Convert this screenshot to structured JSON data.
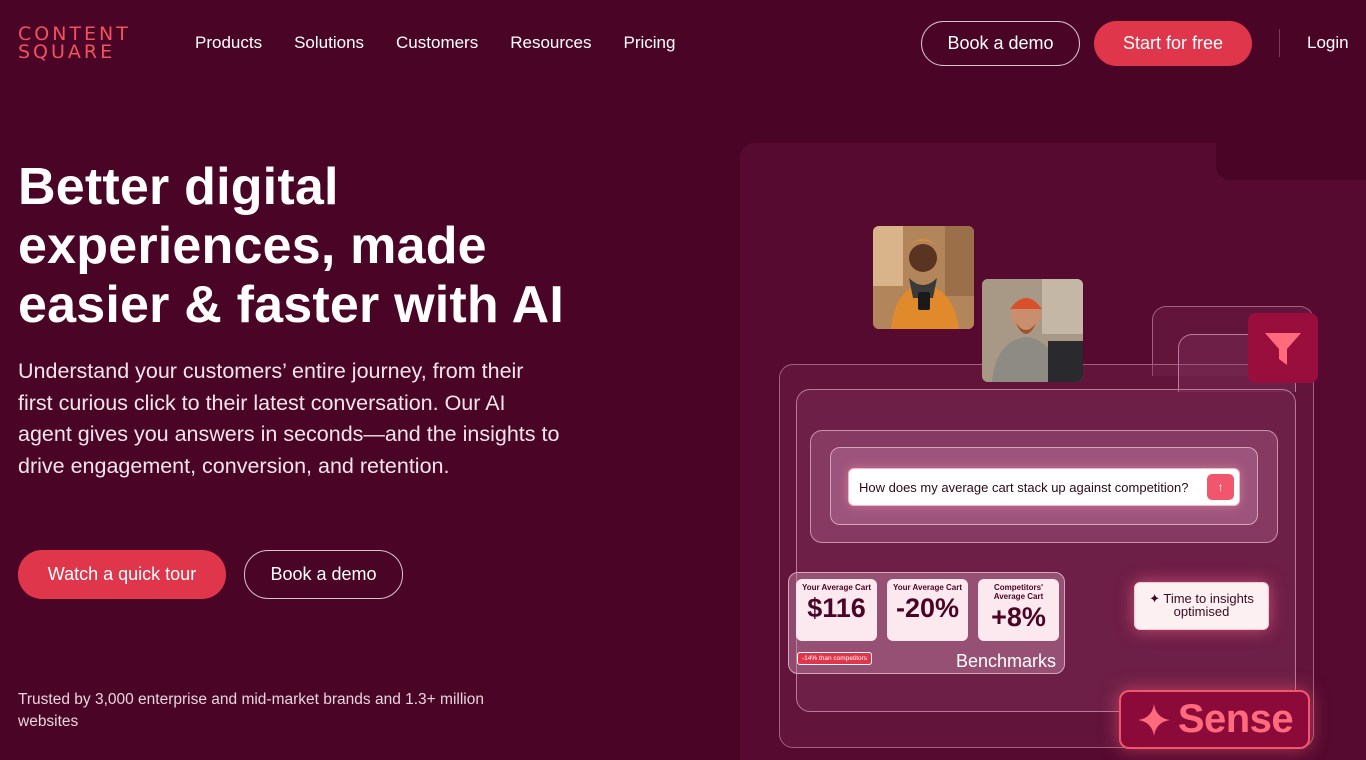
{
  "brand": {
    "logo_line1": "CONTENT",
    "logo_line2": "SQUARE"
  },
  "nav": {
    "links": [
      "Products",
      "Solutions",
      "Customers",
      "Resources",
      "Pricing"
    ],
    "book_demo": "Book a demo",
    "start_free": "Start for free",
    "login": "Login"
  },
  "hero": {
    "title": "Better digital experiences, made easier & faster with AI",
    "subtitle": "Understand your customers’ entire journey, from their first curious click to their latest conversation. Our AI agent gives you answers in seconds—and the insights to drive engagement, conversion, and retention.",
    "cta_primary": "Watch a quick tour",
    "cta_secondary": "Book a demo",
    "trusted": "Trusted by 3,000 enterprise and mid-market brands and 1.3+ million websites"
  },
  "illustration": {
    "question": "How does my average cart stack up against competition?",
    "stats": [
      {
        "label": "Your Average Cart",
        "value": "$116"
      },
      {
        "label": "Your Average Cart",
        "value": "-20%"
      },
      {
        "label": "Competitors' Average Cart",
        "value": "+8%"
      }
    ],
    "tag": "-14% than competitors",
    "bench_title": "Benchmarks",
    "insight": "Time to insights optimised",
    "sense": "Sense"
  },
  "colors": {
    "background": "#4a0426",
    "accent": "#e0364b",
    "logo": "#f2525f"
  }
}
